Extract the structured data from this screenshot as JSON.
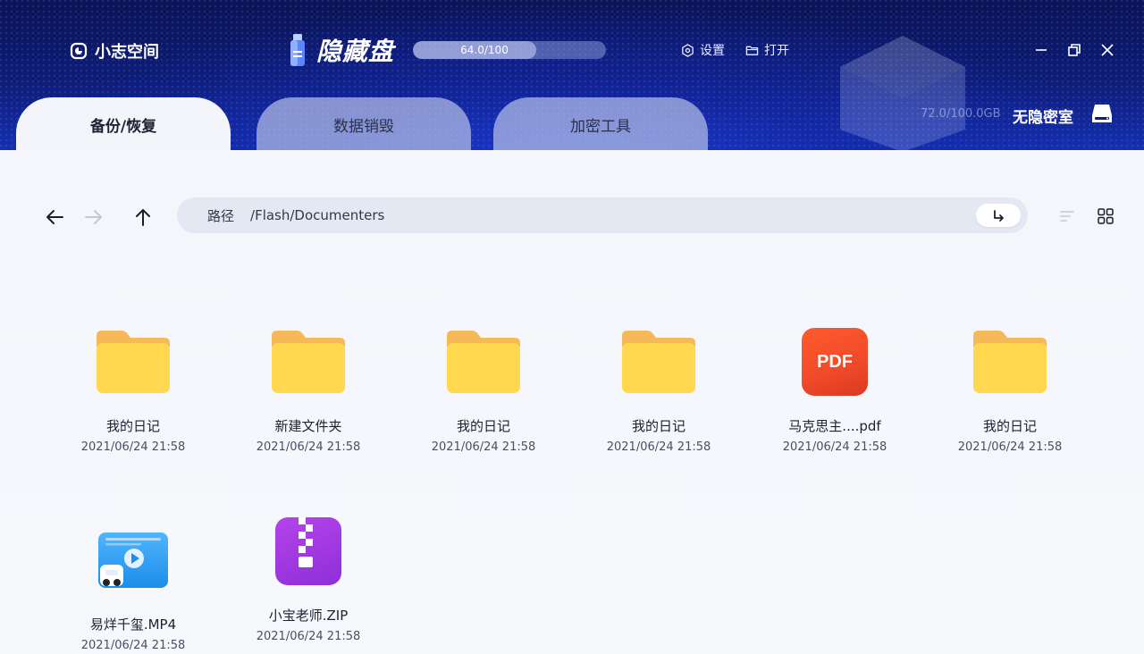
{
  "brand": {
    "name": "小志空间",
    "icon": "brand-logo-icon"
  },
  "product": {
    "title": "隐藏盘",
    "icon": "usb-drive-icon"
  },
  "capacity": {
    "text": "64.0/100",
    "used_fraction": 0.64
  },
  "top_actions": {
    "settings": {
      "label": "设置",
      "icon": "hexagon-gear-icon"
    },
    "open": {
      "label": "打开",
      "icon": "folder-open-icon"
    }
  },
  "window_controls": [
    "minimize-icon",
    "restore-icon",
    "close-icon"
  ],
  "tabs": [
    {
      "label": "备份/恢复",
      "active": true
    },
    {
      "label": "数据销毁",
      "active": false
    },
    {
      "label": "加密工具",
      "active": false
    }
  ],
  "storage": {
    "text": "72.0/100.0GB"
  },
  "vault": {
    "label": "无隐密室",
    "icon": "drive-icon"
  },
  "toolbar": {
    "back_icon": "arrow-left-icon",
    "forward_icon": "arrow-right-icon",
    "up_icon": "arrow-up-icon",
    "path_label": "路径",
    "path_value": "/Flash/Documenters",
    "go_icon": "enter-return-icon",
    "sort_icon": "sort-lines-icon",
    "grid_icon": "grid-view-icon"
  },
  "files": [
    {
      "name": "我的日记",
      "date": "2021/06/24 21:58",
      "type": "folder"
    },
    {
      "name": "新建文件夹",
      "date": "2021/06/24 21:58",
      "type": "folder"
    },
    {
      "name": "我的日记",
      "date": "2021/06/24 21:58",
      "type": "folder"
    },
    {
      "name": "我的日记",
      "date": "2021/06/24 21:58",
      "type": "folder"
    },
    {
      "name": "马克思主....pdf",
      "date": "2021/06/24 21:58",
      "type": "pdf",
      "badge": "PDF"
    },
    {
      "name": "我的日记",
      "date": "2021/06/24 21:58",
      "type": "folder"
    },
    {
      "name": "易烊千玺.MP4",
      "date": "2021/06/24 21:58",
      "type": "video"
    },
    {
      "name": "小宝老师.ZIP",
      "date": "2021/06/24 21:58",
      "type": "zip"
    }
  ],
  "colors": {
    "header_dark": "#0b1455",
    "header_blue": "#1d3ad1",
    "folder_yellow": "#ffd84f",
    "folder_tab": "#f6b95a",
    "pdf_red": "#f04a2a",
    "zip_purple": "#9a35de",
    "content_bg": "#f3f5fa"
  }
}
